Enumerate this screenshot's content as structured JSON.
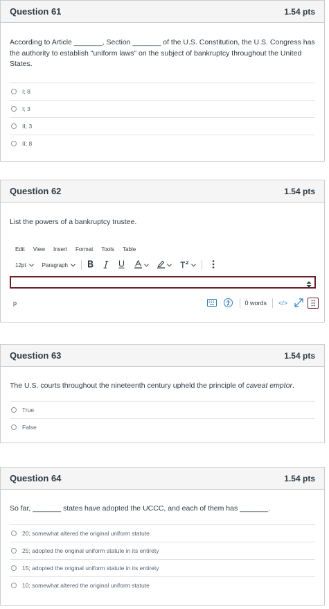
{
  "q61": {
    "title": "Question 61",
    "points": "1.54 pts",
    "text": "According to Article _______, Section _______ of the U.S. Constitution, the U.S. Congress has the authority to establish \"uniform laws\" on the subject of bankruptcy throughout the United States.",
    "answers": [
      "I; 8",
      "I; 3",
      "II; 3",
      "II; 8"
    ]
  },
  "q62": {
    "title": "Question 62",
    "points": "1.54 pts",
    "text": "List the powers of a bankruptcy trustee.",
    "menu": [
      "Edit",
      "View",
      "Insert",
      "Format",
      "Tools",
      "Table"
    ],
    "font_size": "12pt",
    "block_format": "Paragraph",
    "element_path": "p",
    "word_count": "0 words",
    "html_toggle": "</>"
  },
  "q63": {
    "title": "Question 63",
    "points": "1.54 pts",
    "text_before": "The U.S. courts throughout the nineteenth century upheld the principle of ",
    "text_italic": "caveat emptor",
    "text_after": ".",
    "answers": [
      "True",
      "False"
    ]
  },
  "q64": {
    "title": "Question 64",
    "points": "1.54 pts",
    "text": "So far, _______ states have adopted the UCCC, and each of them has _______.",
    "answers": [
      "20; somewhat altered the original uniform statute",
      "25; adopted the original uniform statute in its entirety",
      "15; adopted the original uniform statute in its entirety",
      "10; somewhat altered the original uniform statute"
    ]
  },
  "colors": {
    "accent": "#6b1f2a",
    "link": "#2b7abc",
    "border": "#c7cdd1",
    "header_bg": "#f5f5f5"
  },
  "icons": [
    "chevron-down-icon",
    "more-vertical-icon",
    "keyboard-icon",
    "accessibility-icon",
    "expand-icon",
    "drag-handle-icon",
    "resize-handle-icon"
  ]
}
